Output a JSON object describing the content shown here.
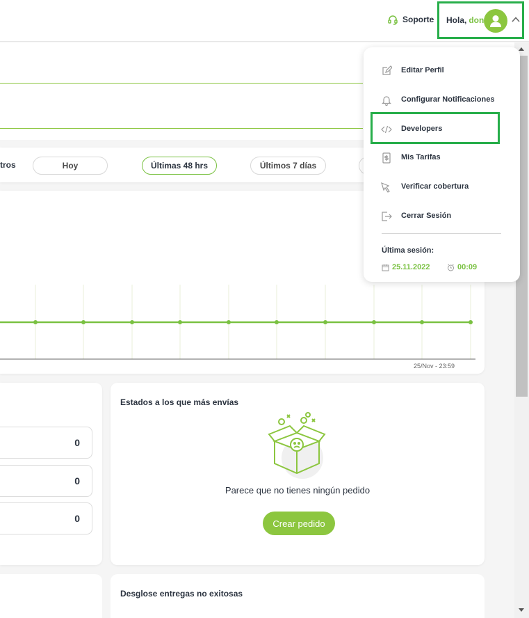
{
  "header": {
    "support_label": "Soporte",
    "greeting": "Hola,",
    "user_name": "don"
  },
  "filters": {
    "label": "tros",
    "options": [
      {
        "label": "Hoy",
        "active": false
      },
      {
        "label": "Últimas 48 hrs",
        "active": true
      },
      {
        "label": "Últimos 7 días",
        "active": false
      }
    ]
  },
  "chart_data": {
    "type": "line",
    "x_end_label": "25/Nov - 23:59",
    "values": [
      0,
      0,
      0,
      0,
      0,
      0,
      0,
      0,
      0,
      0
    ],
    "colors": {
      "line": "#7ac142",
      "grid": "#e8efd8"
    }
  },
  "stats": {
    "values": [
      "0",
      "0",
      "0"
    ]
  },
  "states_card": {
    "title": "Estados a los que más envías",
    "empty_message": "Parece que no tienes ningún pedido",
    "create_button": "Crear pedido"
  },
  "failed_card": {
    "title": "Desglose entregas no exitosas"
  },
  "dropdown": {
    "items": [
      {
        "label": "Editar Perfil",
        "icon": "edit-icon"
      },
      {
        "label": "Configurar Notificaciones",
        "icon": "bell-icon"
      },
      {
        "label": "Developers",
        "icon": "code-icon"
      },
      {
        "label": "Mis Tarifas",
        "icon": "receipt-icon"
      },
      {
        "label": "Verificar cobertura",
        "icon": "coverage-icon"
      },
      {
        "label": "Cerrar Sesión",
        "icon": "logout-icon"
      }
    ],
    "session_label": "Última sesión:",
    "session_date": "25.11.2022",
    "session_time": "00:09"
  },
  "colors": {
    "brand_green": "#8cc63f",
    "highlight_border": "#27ae4a",
    "text_dark": "#2c3440"
  }
}
